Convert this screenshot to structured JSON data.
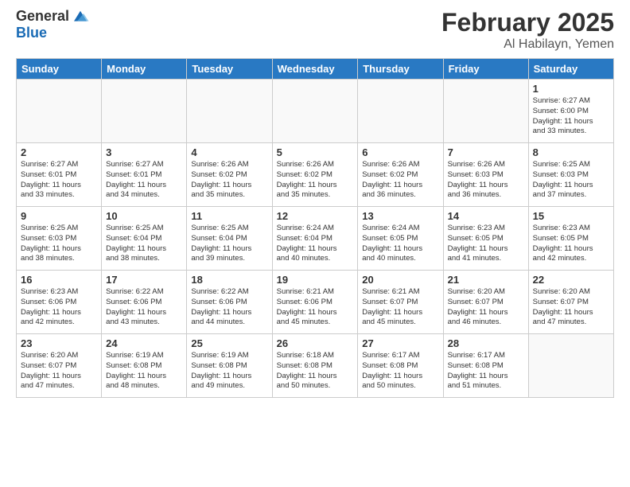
{
  "header": {
    "logo_general": "General",
    "logo_blue": "Blue",
    "month_title": "February 2025",
    "location": "Al Habilayn, Yemen"
  },
  "weekdays": [
    "Sunday",
    "Monday",
    "Tuesday",
    "Wednesday",
    "Thursday",
    "Friday",
    "Saturday"
  ],
  "weeks": [
    [
      {
        "day": "",
        "info": ""
      },
      {
        "day": "",
        "info": ""
      },
      {
        "day": "",
        "info": ""
      },
      {
        "day": "",
        "info": ""
      },
      {
        "day": "",
        "info": ""
      },
      {
        "day": "",
        "info": ""
      },
      {
        "day": "1",
        "info": "Sunrise: 6:27 AM\nSunset: 6:00 PM\nDaylight: 11 hours\nand 33 minutes."
      }
    ],
    [
      {
        "day": "2",
        "info": "Sunrise: 6:27 AM\nSunset: 6:01 PM\nDaylight: 11 hours\nand 33 minutes."
      },
      {
        "day": "3",
        "info": "Sunrise: 6:27 AM\nSunset: 6:01 PM\nDaylight: 11 hours\nand 34 minutes."
      },
      {
        "day": "4",
        "info": "Sunrise: 6:26 AM\nSunset: 6:02 PM\nDaylight: 11 hours\nand 35 minutes."
      },
      {
        "day": "5",
        "info": "Sunrise: 6:26 AM\nSunset: 6:02 PM\nDaylight: 11 hours\nand 35 minutes."
      },
      {
        "day": "6",
        "info": "Sunrise: 6:26 AM\nSunset: 6:02 PM\nDaylight: 11 hours\nand 36 minutes."
      },
      {
        "day": "7",
        "info": "Sunrise: 6:26 AM\nSunset: 6:03 PM\nDaylight: 11 hours\nand 36 minutes."
      },
      {
        "day": "8",
        "info": "Sunrise: 6:25 AM\nSunset: 6:03 PM\nDaylight: 11 hours\nand 37 minutes."
      }
    ],
    [
      {
        "day": "9",
        "info": "Sunrise: 6:25 AM\nSunset: 6:03 PM\nDaylight: 11 hours\nand 38 minutes."
      },
      {
        "day": "10",
        "info": "Sunrise: 6:25 AM\nSunset: 6:04 PM\nDaylight: 11 hours\nand 38 minutes."
      },
      {
        "day": "11",
        "info": "Sunrise: 6:25 AM\nSunset: 6:04 PM\nDaylight: 11 hours\nand 39 minutes."
      },
      {
        "day": "12",
        "info": "Sunrise: 6:24 AM\nSunset: 6:04 PM\nDaylight: 11 hours\nand 40 minutes."
      },
      {
        "day": "13",
        "info": "Sunrise: 6:24 AM\nSunset: 6:05 PM\nDaylight: 11 hours\nand 40 minutes."
      },
      {
        "day": "14",
        "info": "Sunrise: 6:23 AM\nSunset: 6:05 PM\nDaylight: 11 hours\nand 41 minutes."
      },
      {
        "day": "15",
        "info": "Sunrise: 6:23 AM\nSunset: 6:05 PM\nDaylight: 11 hours\nand 42 minutes."
      }
    ],
    [
      {
        "day": "16",
        "info": "Sunrise: 6:23 AM\nSunset: 6:06 PM\nDaylight: 11 hours\nand 42 minutes."
      },
      {
        "day": "17",
        "info": "Sunrise: 6:22 AM\nSunset: 6:06 PM\nDaylight: 11 hours\nand 43 minutes."
      },
      {
        "day": "18",
        "info": "Sunrise: 6:22 AM\nSunset: 6:06 PM\nDaylight: 11 hours\nand 44 minutes."
      },
      {
        "day": "19",
        "info": "Sunrise: 6:21 AM\nSunset: 6:06 PM\nDaylight: 11 hours\nand 45 minutes."
      },
      {
        "day": "20",
        "info": "Sunrise: 6:21 AM\nSunset: 6:07 PM\nDaylight: 11 hours\nand 45 minutes."
      },
      {
        "day": "21",
        "info": "Sunrise: 6:20 AM\nSunset: 6:07 PM\nDaylight: 11 hours\nand 46 minutes."
      },
      {
        "day": "22",
        "info": "Sunrise: 6:20 AM\nSunset: 6:07 PM\nDaylight: 11 hours\nand 47 minutes."
      }
    ],
    [
      {
        "day": "23",
        "info": "Sunrise: 6:20 AM\nSunset: 6:07 PM\nDaylight: 11 hours\nand 47 minutes."
      },
      {
        "day": "24",
        "info": "Sunrise: 6:19 AM\nSunset: 6:08 PM\nDaylight: 11 hours\nand 48 minutes."
      },
      {
        "day": "25",
        "info": "Sunrise: 6:19 AM\nSunset: 6:08 PM\nDaylight: 11 hours\nand 49 minutes."
      },
      {
        "day": "26",
        "info": "Sunrise: 6:18 AM\nSunset: 6:08 PM\nDaylight: 11 hours\nand 50 minutes."
      },
      {
        "day": "27",
        "info": "Sunrise: 6:17 AM\nSunset: 6:08 PM\nDaylight: 11 hours\nand 50 minutes."
      },
      {
        "day": "28",
        "info": "Sunrise: 6:17 AM\nSunset: 6:08 PM\nDaylight: 11 hours\nand 51 minutes."
      },
      {
        "day": "",
        "info": ""
      }
    ]
  ]
}
